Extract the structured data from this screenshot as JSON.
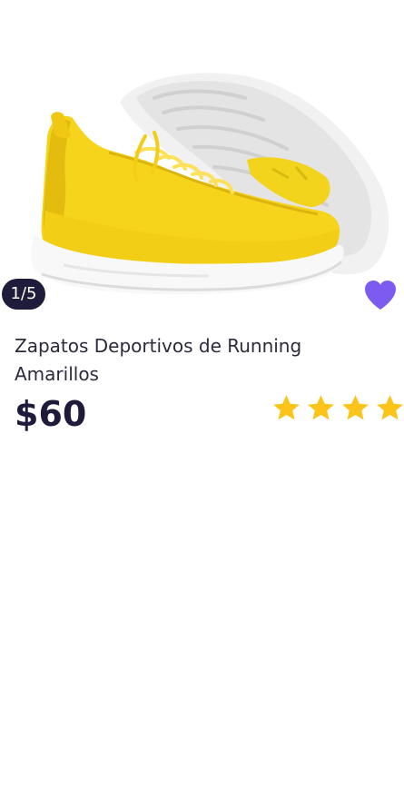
{
  "gallery": {
    "image_alt": "yellow-running-shoes",
    "counter": "1/5"
  },
  "favorite": {
    "icon": "heart-icon",
    "state": "active",
    "color": "#7c5cf0"
  },
  "product": {
    "title": "Zapatos Deportivos de Running Amarillos",
    "price": "$60",
    "rating": 4,
    "star_color": "#fcc419"
  }
}
